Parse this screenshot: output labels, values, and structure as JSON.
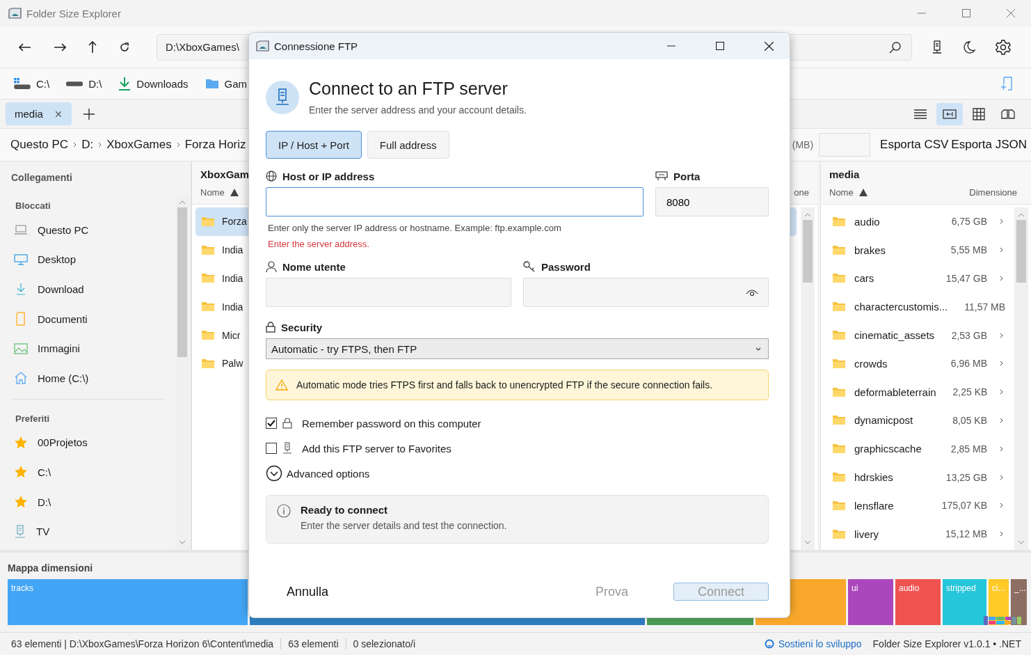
{
  "window": {
    "title": "Folder Size Explorer"
  },
  "toolbar": {
    "address": "D:\\XboxGames\\"
  },
  "quick_access": [
    {
      "label": "C:\\",
      "kind": "system-drive"
    },
    {
      "label": "D:\\",
      "kind": "drive"
    },
    {
      "label": "Downloads",
      "kind": "download"
    },
    {
      "label": "Gam",
      "kind": "folder"
    }
  ],
  "tabs": [
    {
      "label": "media",
      "selected": true
    }
  ],
  "view_modes": [
    {
      "kind": "list",
      "selected": false
    },
    {
      "kind": "panes",
      "selected": true
    },
    {
      "kind": "grid",
      "selected": false
    },
    {
      "kind": "compare",
      "selected": false
    }
  ],
  "breadcrumb": [
    "Questo PC",
    "D:",
    "XboxGames",
    "Forza Horiz"
  ],
  "filter": {
    "label": "(MB)"
  },
  "export_buttons": [
    "Esporta CSV",
    "Esporta JSON"
  ],
  "sidebar": {
    "title": "Collegamenti",
    "sections": [
      {
        "title": "Bloccati",
        "items": [
          {
            "label": "Questo PC",
            "kind": "pc"
          },
          {
            "label": "Desktop",
            "kind": "desktop"
          },
          {
            "label": "Download",
            "kind": "download"
          },
          {
            "label": "Documenti",
            "kind": "document"
          },
          {
            "label": "Immagini",
            "kind": "image"
          },
          {
            "label": "Home (C:\\)",
            "kind": "home"
          }
        ]
      },
      {
        "title": "Preferiti",
        "items": [
          {
            "label": "00Projetos",
            "kind": "star"
          },
          {
            "label": "C:\\",
            "kind": "star"
          },
          {
            "label": "D:\\",
            "kind": "star"
          },
          {
            "label": "TV",
            "kind": "server"
          }
        ]
      }
    ]
  },
  "columns": [
    {
      "title": "XboxGam",
      "sort_label": "Nome",
      "size_heading": "one",
      "rows": [
        {
          "name": "Forza",
          "selected": true
        },
        {
          "name": "India",
          "selected": false
        },
        {
          "name": "India",
          "selected": false
        },
        {
          "name": "India",
          "selected": false
        },
        {
          "name": "Micr",
          "selected": false
        },
        {
          "name": "Palw",
          "selected": false
        }
      ]
    },
    {
      "title": "media",
      "sort_label": "Nome",
      "size_heading": "Dimensione",
      "rows": [
        {
          "name": "audio",
          "size": "6,75 GB",
          "selected": false
        },
        {
          "name": "brakes",
          "size": "5,55 MB",
          "selected": false
        },
        {
          "name": "cars",
          "size": "15,47 GB",
          "selected": false
        },
        {
          "name": "charactercustomis...",
          "size": "11,57 MB",
          "selected": false
        },
        {
          "name": "cinematic_assets",
          "size": "2,53 GB",
          "selected": false
        },
        {
          "name": "crowds",
          "size": "6,96 MB",
          "selected": false
        },
        {
          "name": "deformableterrain",
          "size": "2,25 KB",
          "selected": false
        },
        {
          "name": "dynamicpost",
          "size": "8,05 KB",
          "selected": false
        },
        {
          "name": "graphicscache",
          "size": "2,85 MB",
          "selected": false
        },
        {
          "name": "hdrskies",
          "size": "13,25 GB",
          "selected": false
        },
        {
          "name": "lensflare",
          "size": "175,07 KB",
          "selected": false
        },
        {
          "name": "livery",
          "size": "15,12 MB",
          "selected": false
        }
      ]
    }
  ],
  "size_map": {
    "title": "Mappa dimensioni",
    "blocks": [
      {
        "label": "tracks",
        "color": "#42a5f5"
      },
      {
        "color": "#2e7cc0"
      },
      {
        "color": "#4b9a52"
      },
      {
        "color": "#f9a82b"
      },
      {
        "label": "ui",
        "color": "#ab47bc"
      },
      {
        "label": "audio",
        "color": "#ef5350"
      },
      {
        "label": "stripped",
        "color": "#26c6da"
      },
      {
        "label": "ci...",
        "color": "#ffca28"
      },
      {
        "label": "_...",
        "color": "#8d6e63"
      }
    ]
  },
  "status_bar": {
    "items": [
      "63 elementi | D:\\XboxGames\\Forza Horizon 6\\Content\\media",
      "63 elementi",
      "0 selezionato/i"
    ],
    "support_link": "Sostieni lo sviluppo",
    "version": "Folder Size Explorer v1.0.1 • .NET"
  },
  "dialog": {
    "title": "Connessione FTP",
    "heading": "Connect to an FTP server",
    "subheading": "Enter the server address and your account details.",
    "modes": [
      {
        "label": "IP / Host + Port",
        "selected": true
      },
      {
        "label": "Full address",
        "selected": false
      }
    ],
    "host": {
      "label": "Host or IP address",
      "hint": "Enter only the server IP address or hostname. Example: ftp.example.com",
      "error": "Enter the server address."
    },
    "port": {
      "label": "Porta",
      "value": "8080"
    },
    "username": {
      "label": "Nome utente"
    },
    "password": {
      "label": "Password"
    },
    "security": {
      "label": "Security",
      "value": "Automatic - try FTPS, then FTP"
    },
    "warning": "Automatic mode tries FTPS first and falls back to unencrypted FTP if the secure connection fails.",
    "options": [
      {
        "label": "Remember password on this computer",
        "checked": true,
        "kind": "lock"
      },
      {
        "label": "Add this FTP server to Favorites",
        "checked": false,
        "kind": "server"
      }
    ],
    "advanced": {
      "label": "Advanced options",
      "expanded": false
    },
    "status": {
      "title": "Ready to connect",
      "message": "Enter the server details and test the connection."
    },
    "buttons": [
      {
        "label": "Annulla",
        "kind": "cancel",
        "disabled": false
      },
      {
        "label": "Prova",
        "kind": "test",
        "disabled": true
      },
      {
        "label": "Connect",
        "kind": "connect",
        "disabled": true
      }
    ]
  }
}
